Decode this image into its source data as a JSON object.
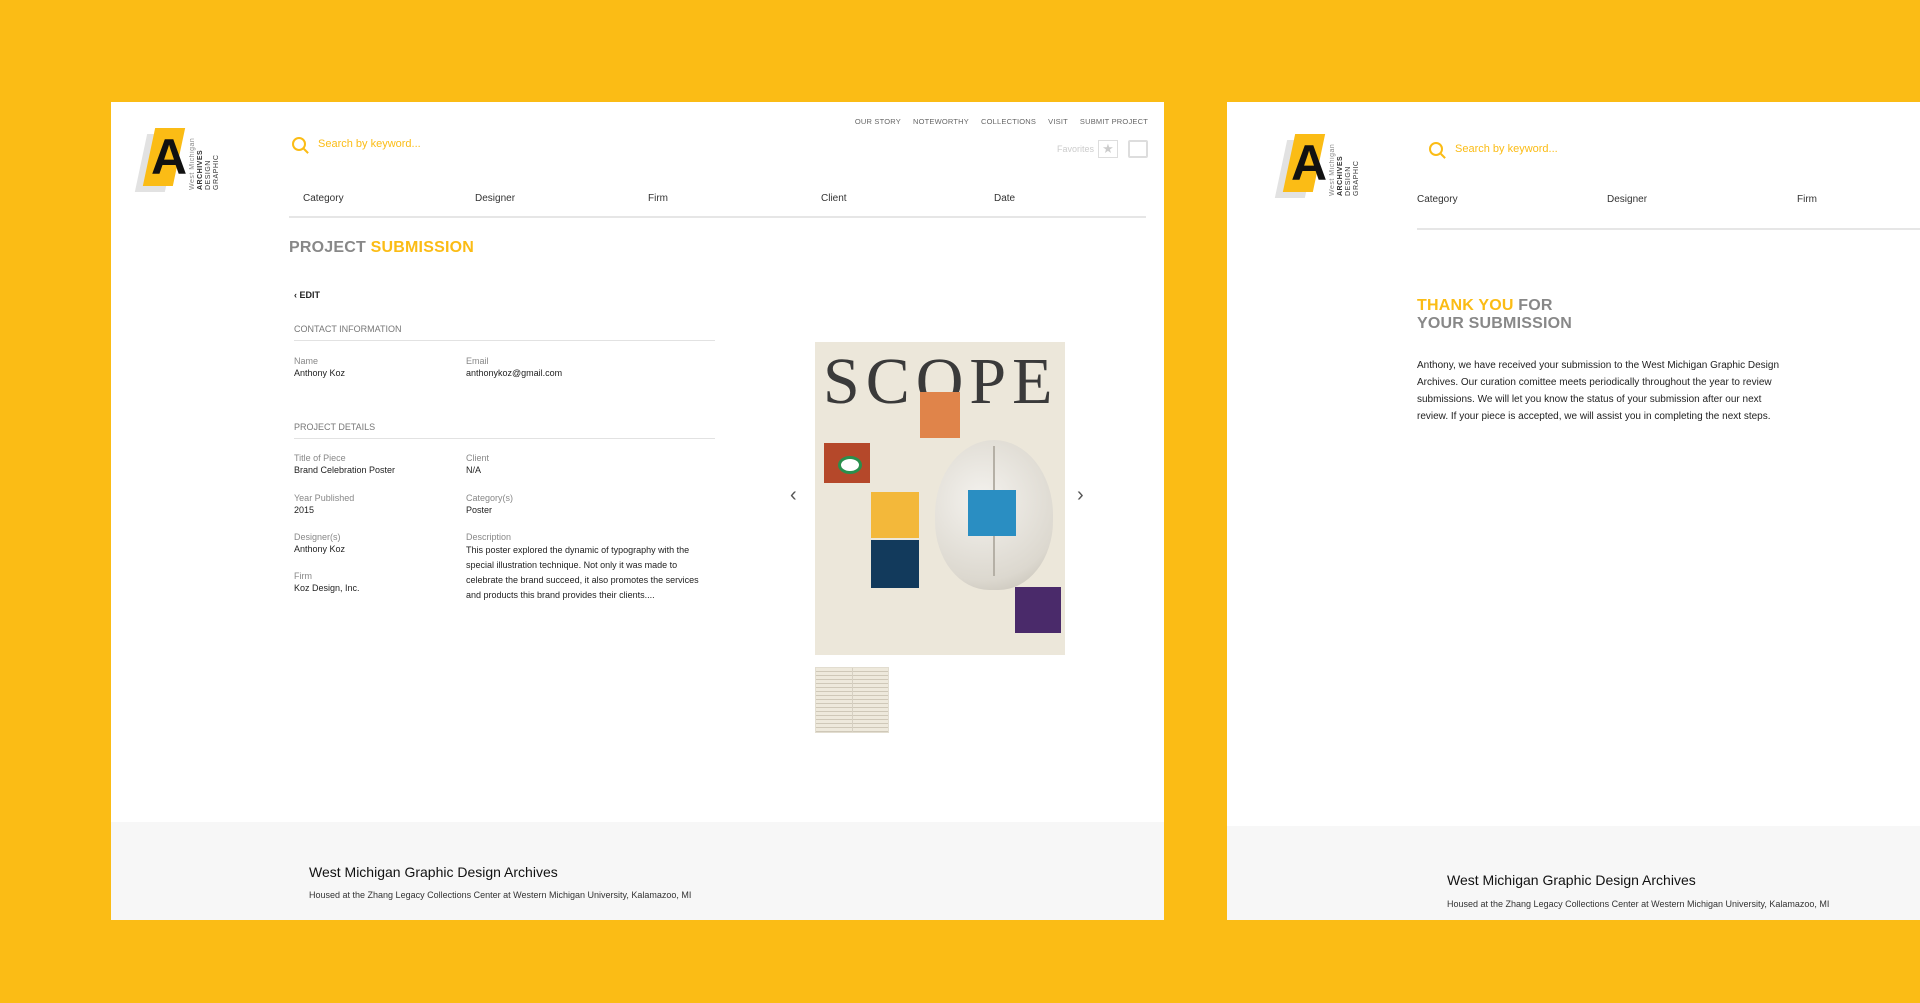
{
  "brand": {
    "logo_letter": "A",
    "logo_lines": [
      "GRAPHIC",
      "DESIGN",
      "ARCHIVES",
      "West Michigan"
    ]
  },
  "search": {
    "placeholder": "Search by keyword..."
  },
  "topnav": [
    "OUR STORY",
    "NOTEWORTHY",
    "COLLECTIONS",
    "VISIT",
    "SUBMIT PROJECT"
  ],
  "tools": {
    "favorites_label": "Favorites",
    "star_icon": "star-icon",
    "print_icon": "printer-icon"
  },
  "filters": [
    "Category",
    "Designer",
    "Firm",
    "Client",
    "Date"
  ],
  "submission": {
    "title_plain": "PROJECT",
    "title_accent": "SUBMISSION",
    "edit_label": "EDIT",
    "contact_heading": "CONTACT INFORMATION",
    "details_heading": "PROJECT DETAILS",
    "name": {
      "label": "Name",
      "value": "Anthony Koz"
    },
    "email": {
      "label": "Email",
      "value": "anthonykoz@gmail.com"
    },
    "title_of_piece": {
      "label": "Title of  Piece",
      "value": "Brand Celebration Poster"
    },
    "client": {
      "label": "Client",
      "value": "N/A"
    },
    "year": {
      "label": "Year Published",
      "value": "2015"
    },
    "category": {
      "label": "Category(s)",
      "value": "Poster"
    },
    "designer": {
      "label": "Designer(s)",
      "value": "Anthony Koz"
    },
    "description": {
      "label": "Description",
      "value": "This poster explored the dynamic of typography with the special illustration technique. Not only it was made to celebrate the brand succeed, it also promotes the services and products this brand provides their clients...."
    },
    "firm": {
      "label": "Firm",
      "value": "Koz Design, Inc."
    },
    "poster_word": "SCOPE",
    "prev_arrow": "‹",
    "next_arrow": "›"
  },
  "thankyou": {
    "title_accent": "THANK YOU",
    "title_plain_1": "FOR",
    "title_plain_2": "YOUR SUBMISSION",
    "body": "Anthony, we have received your submission to the West Michigan Graphic Design Archives. Our curation comittee meets periodically throughout the year to review submissions. We will let you know the status of your submission after our next review. If your piece is accepted, we will assist you in completing the next steps."
  },
  "footer": {
    "org": "West Michigan Graphic Design Archives",
    "address": "Housed at the Zhang Legacy Collections Center at Western Michigan University, Kalamazoo, MI"
  },
  "colors": {
    "accent": "#FBBC15",
    "muted": "#888888"
  }
}
